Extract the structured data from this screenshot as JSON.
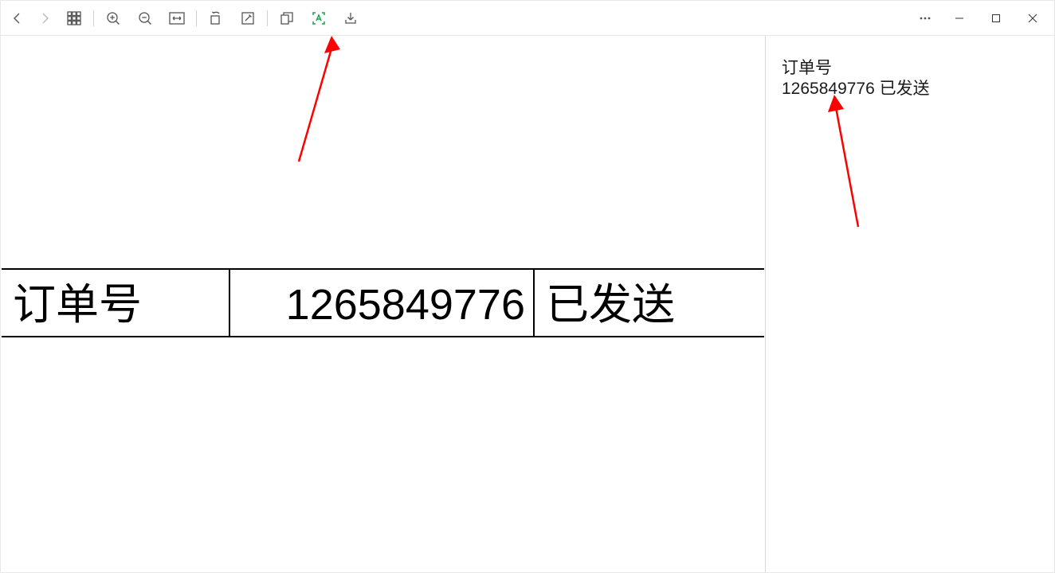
{
  "toolbar": {
    "icons": {
      "back": "back-icon",
      "forward": "forward-icon",
      "thumbnails": "grid-icon",
      "zoom_in": "zoom-in-icon",
      "zoom_out": "zoom-out-icon",
      "fit": "fit-width-icon",
      "rotate": "rotate-icon",
      "edit": "edit-icon",
      "copy": "copy-icon",
      "ocr": "ocr-icon",
      "download": "download-icon",
      "more": "more-icon",
      "minimize": "minimize-icon",
      "maximize": "maximize-icon",
      "close": "close-icon"
    }
  },
  "image_content": {
    "cells": [
      "订单号",
      "1265849776",
      "已发送"
    ]
  },
  "ocr_panel": {
    "lines": [
      "订单号",
      "1265849776 已发送"
    ]
  },
  "annotations": {
    "arrow_color": "#ff0000"
  }
}
